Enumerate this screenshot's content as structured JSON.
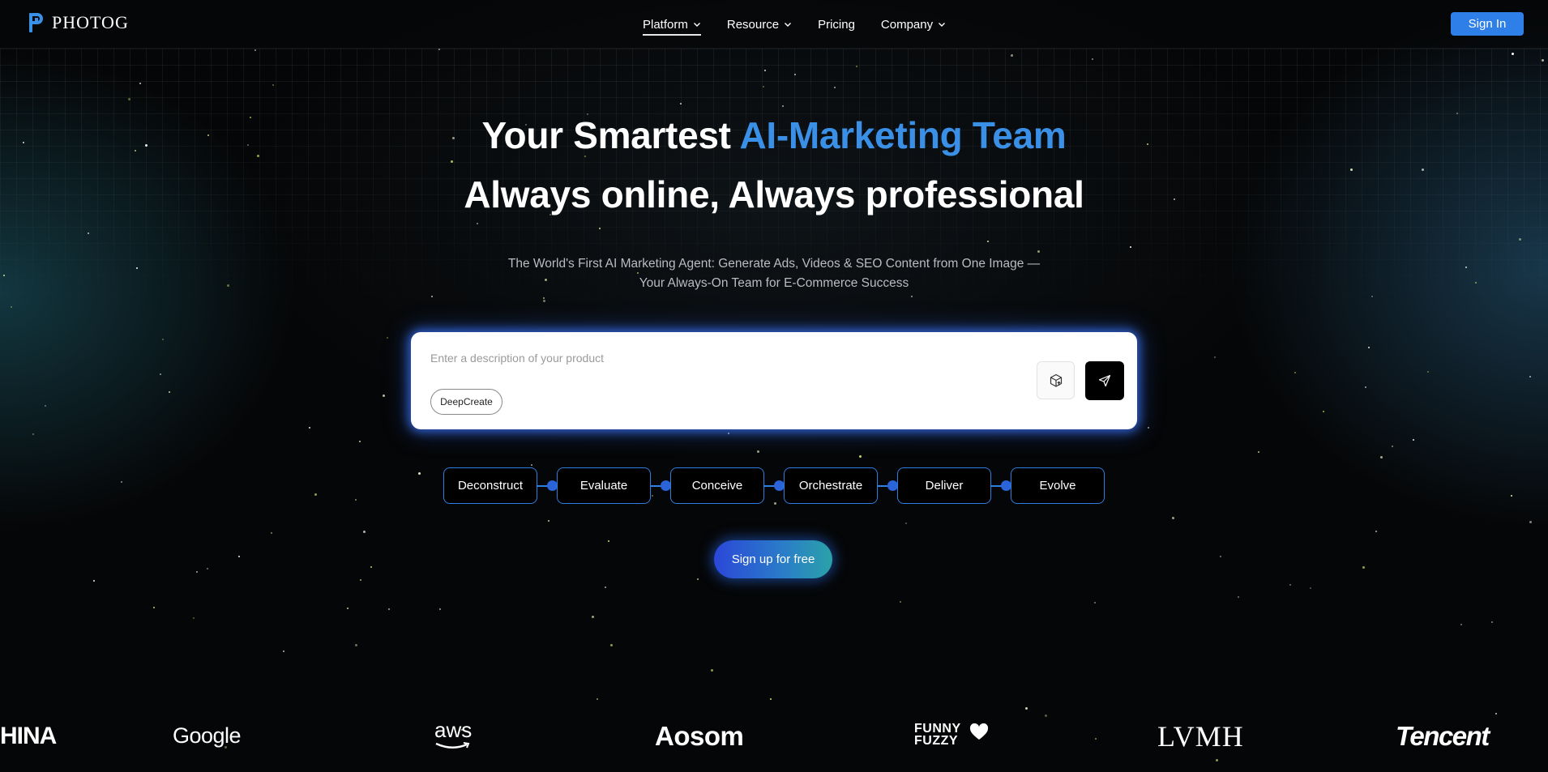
{
  "nav": {
    "logo_text": "PHOTOG",
    "items": [
      {
        "label": "Platform",
        "has_dropdown": true,
        "active": true
      },
      {
        "label": "Resource",
        "has_dropdown": true,
        "active": false
      },
      {
        "label": "Pricing",
        "has_dropdown": false,
        "active": false
      },
      {
        "label": "Company",
        "has_dropdown": true,
        "active": false
      }
    ],
    "signin_label": "Sign In"
  },
  "hero": {
    "title_prefix": "Your Smartest ",
    "title_accent": "AI-Marketing Team",
    "title_line2": "Always online, Always professional",
    "subtitle_line1": "The World's First AI Marketing Agent: Generate Ads, Videos & SEO Content from One Image —",
    "subtitle_line2": "Your Always-On Team for E-Commerce Success"
  },
  "prompt": {
    "placeholder": "Enter a description of your product",
    "value": "",
    "chip_label": "DeepCreate",
    "upload_icon": "box-upload-icon",
    "send_icon": "paper-plane-icon"
  },
  "steps": [
    "Deconstruct",
    "Evaluate",
    "Conceive",
    "Orchestrate",
    "Deliver",
    "Evolve"
  ],
  "cta_label": "Sign up for free",
  "brands": {
    "china": "HINA",
    "google": "Google",
    "aws": "aws",
    "aosom": "Aosom",
    "funny_line1": "FUNNY",
    "funny_line2": "FUZZY",
    "lvmh": "LVMH",
    "tencent": "Tencent"
  },
  "colors": {
    "accent": "#3a8fe6",
    "signin_bg": "#2f7fe8",
    "step_border": "#2f7fe0",
    "background": "#050607"
  }
}
